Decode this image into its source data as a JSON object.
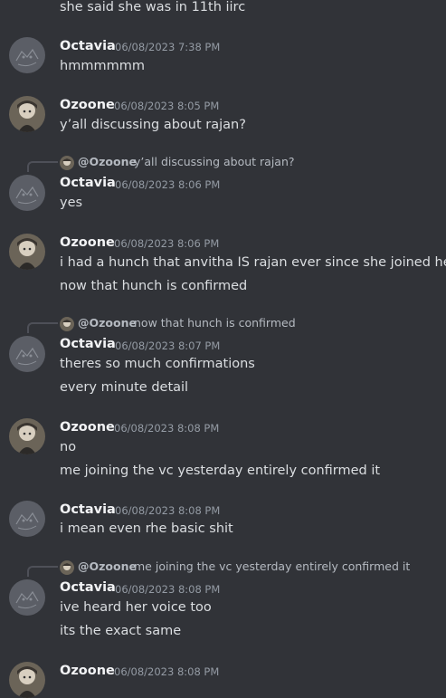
{
  "messages": [
    {
      "type": "continuation",
      "text": "she said she was in 11th iirc"
    },
    {
      "author": "Octavia",
      "timestamp": "06/08/2023 7:38 PM",
      "lines": [
        "hmmmmmm"
      ]
    },
    {
      "author": "Ozoone",
      "timestamp": "06/08/2023 8:05 PM",
      "lines": [
        "y’all discussing about rajan?"
      ]
    },
    {
      "author": "Octavia",
      "timestamp": "06/08/2023 8:06 PM",
      "reply": {
        "mention": "@Ozoone",
        "text": "y’all discussing about rajan?"
      },
      "lines": [
        "yes"
      ]
    },
    {
      "author": "Ozoone",
      "timestamp": "06/08/2023 8:06 PM",
      "lines": [
        "i had a hunch that anvitha IS rajan ever since she joined here",
        "now that hunch is confirmed"
      ]
    },
    {
      "author": "Octavia",
      "timestamp": "06/08/2023 8:07 PM",
      "reply": {
        "mention": "@Ozoone",
        "text": "now that hunch is confirmed"
      },
      "lines": [
        "theres so much confirmations",
        "every minute detail"
      ]
    },
    {
      "author": "Ozoone",
      "timestamp": "06/08/2023 8:08 PM",
      "lines": [
        "no",
        "me joining the vc yesterday entirely confirmed it"
      ]
    },
    {
      "author": "Octavia",
      "timestamp": "06/08/2023 8:08 PM",
      "lines": [
        "i mean even rhe basic shit"
      ]
    },
    {
      "author": "Octavia",
      "timestamp": "06/08/2023 8:08 PM",
      "reply": {
        "mention": "@Ozoone",
        "text": "me joining the vc yesterday entirely confirmed it"
      },
      "lines": [
        "ive heard her voice too",
        "its the exact same"
      ]
    },
    {
      "author": "Ozoone",
      "timestamp": "06/08/2023 8:08 PM",
      "lines": []
    }
  ],
  "icons": {
    "octavia_avatar": "cat-sketch-avatar",
    "ozoone_avatar": "anime-character-avatar"
  },
  "colors": {
    "background": "#313338",
    "username": "#f2f3f5",
    "timestamp": "#949ba4",
    "text": "#dbdee1"
  }
}
